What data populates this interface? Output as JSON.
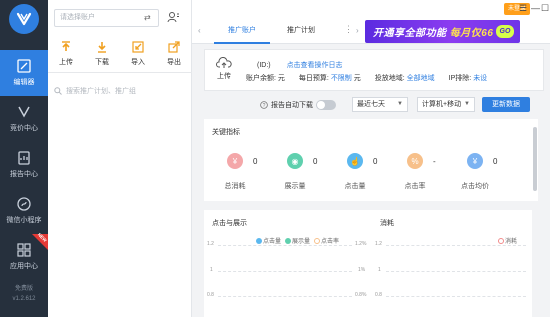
{
  "rail": {
    "items": [
      {
        "label": "编辑器",
        "icon": "editor-icon",
        "active": true
      },
      {
        "label": "竞价中心",
        "icon": "bid-center-icon",
        "active": false
      },
      {
        "label": "报告中心",
        "icon": "report-center-icon",
        "active": false
      },
      {
        "label": "微信小程序",
        "icon": "wechat-miniprogram-icon",
        "active": false
      },
      {
        "label": "应用中心",
        "icon": "app-center-icon",
        "active": false
      }
    ],
    "new_badge": "NEW",
    "footer_label": "免费版",
    "version": "v1.2.612"
  },
  "tree": {
    "account_placeholder": "请选择账户",
    "tools": [
      {
        "label": "上传",
        "icon": "upload-arrow-icon"
      },
      {
        "label": "下载",
        "icon": "download-arrow-icon"
      },
      {
        "label": "导入",
        "icon": "import-icon"
      },
      {
        "label": "导出",
        "icon": "export-icon"
      }
    ],
    "search_placeholder": "搜索推广计划、推广组"
  },
  "header": {
    "tabs": [
      {
        "label": "推广账户",
        "active": true
      },
      {
        "label": "推广计划",
        "active": false
      }
    ],
    "banner_text_a": "开通享全部功能",
    "banner_text_b": "每月仅",
    "banner_price": "66",
    "banner_go": "GO",
    "login_label": "未登录"
  },
  "account_info": {
    "upload_label": "上传",
    "id_text": "(ID:)",
    "log_link": "点击查看操作日志",
    "balance_label": "账户余额:",
    "balance_unit": "元",
    "budget_label": "每日预算:",
    "budget_value": "不限制",
    "budget_unit": "元",
    "region_label": "投放地域:",
    "region_value": "全部地域",
    "ip_label": "IP排除:",
    "ip_value": "未设"
  },
  "controls": {
    "auto_download": "报告自动下载",
    "range": "最近七天",
    "device": "计算机+移动",
    "refresh": "更新数据"
  },
  "metrics": {
    "title": "关键指标",
    "items": [
      {
        "label": "总消耗",
        "value": "0",
        "color": "#f4a7a9",
        "icon": "yen-icon"
      },
      {
        "label": "展示量",
        "value": "0",
        "color": "#5fd0ae",
        "icon": "eye-icon"
      },
      {
        "label": "点击量",
        "value": "0",
        "color": "#5bb8ef",
        "icon": "click-icon"
      },
      {
        "label": "点击率",
        "value": "-",
        "color": "#f7c08a",
        "icon": "percent-icon"
      },
      {
        "label": "点击均价",
        "value": "0",
        "color": "#7cb3f2",
        "icon": "avg-price-icon"
      }
    ]
  },
  "charts": {
    "left_title": "点击与展示",
    "right_title": "消耗",
    "legend_left": [
      {
        "name": "点击量",
        "color": "#5bb8ef"
      },
      {
        "name": "展示量",
        "color": "#5fd0ae"
      },
      {
        "name": "点击率",
        "color": "#f7c08a"
      }
    ],
    "legend_right": [
      {
        "name": "消耗",
        "color": "#f28b8b"
      }
    ],
    "left_y_ticks": [
      "1.2",
      "1",
      "0.8"
    ],
    "left_y2_ticks": [
      "1.2%",
      "1%",
      "0.8%"
    ],
    "right_y_ticks": [
      "1.2",
      "1",
      "0.8"
    ]
  }
}
